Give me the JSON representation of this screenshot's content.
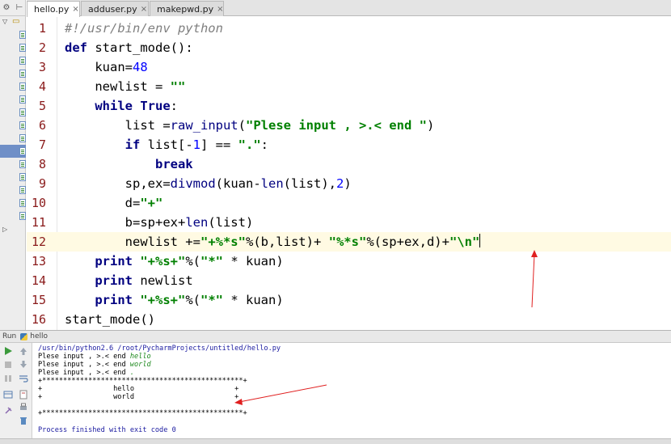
{
  "tabs": [
    {
      "label": "hello.py",
      "active": true
    },
    {
      "label": "adduser.py",
      "active": false
    },
    {
      "label": "makepwd.py",
      "active": false
    }
  ],
  "tab_close_glyph": "×",
  "editor": {
    "current_line": 12,
    "lines": [
      {
        "n": "1",
        "text": "#!/usr/bin/env python"
      },
      {
        "n": "2",
        "text": "def start_mode():"
      },
      {
        "n": "3",
        "text": "    kuan=48"
      },
      {
        "n": "4",
        "text": "    newlist = \"\""
      },
      {
        "n": "5",
        "text": "    while True:"
      },
      {
        "n": "6",
        "text": "        list =raw_input(\"Plese input , >.< end \")"
      },
      {
        "n": "7",
        "text": "        if list[-1] == \".\":"
      },
      {
        "n": "8",
        "text": "            break"
      },
      {
        "n": "9",
        "text": "        sp,ex=divmod(kuan-len(list),2)"
      },
      {
        "n": "10",
        "text": "        d=\"+\""
      },
      {
        "n": "11",
        "text": "        b=sp+ex+len(list)"
      },
      {
        "n": "12",
        "text": "        newlist +=\"+%*s\"%(b,list)+ \"%*s\"%(sp+ex,d)+\"\\n\""
      },
      {
        "n": "13",
        "text": "    print \"+%s+\"%(\"*\" * kuan)"
      },
      {
        "n": "14",
        "text": "    print newlist"
      },
      {
        "n": "15",
        "text": "    print \"+%s+\"%(\"*\" * kuan)"
      },
      {
        "n": "16",
        "text": "start_mode()"
      }
    ]
  },
  "run_panel": {
    "run_label": "Run",
    "config_name": "hello",
    "command": "/usr/bin/python2.6 /root/PycharmProjects/untitled/hello.py",
    "prompt": "Plese input , >.< end ",
    "inputs": [
      "hello",
      "world",
      "."
    ],
    "border_line": "+************************************************+",
    "output_rows": [
      "+                 hello                        +",
      "+                 world                        +"
    ],
    "exit_message": "Process finished with exit code 0"
  },
  "colors": {
    "keyword": "#000080",
    "string": "#008000",
    "number": "#0000ff",
    "comment": "#808080",
    "line_number": "#8a1a1a",
    "current_line_bg": "#fffae3",
    "annotation_arrow": "#e02020"
  },
  "icons": [
    "settings-icon",
    "collapse-icon",
    "python-file-icon",
    "close-icon",
    "rerun-icon",
    "stop-icon",
    "pause-icon",
    "scroll-up-icon",
    "scroll-down-icon",
    "soft-wrap-icon",
    "print-icon",
    "trash-icon",
    "pin-icon"
  ]
}
